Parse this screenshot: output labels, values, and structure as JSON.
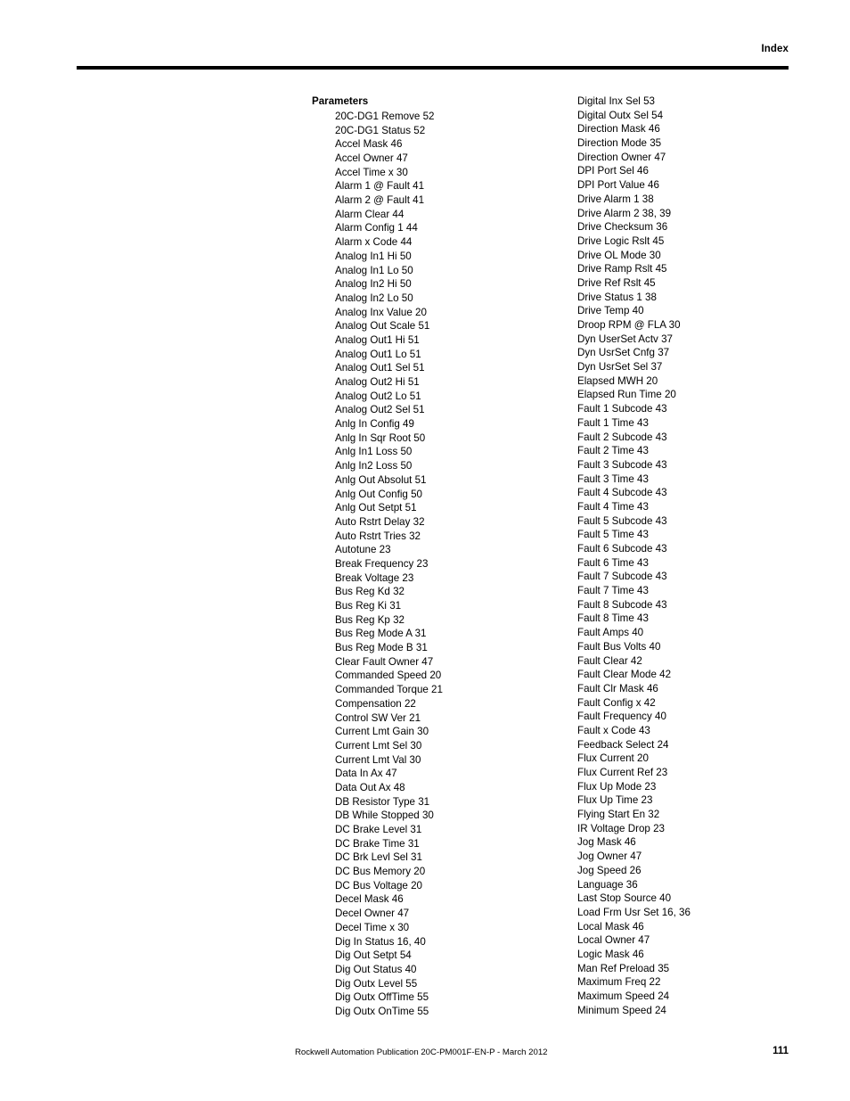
{
  "header": {
    "title": "Index"
  },
  "index": {
    "left_column": {
      "heading": "Parameters",
      "entries": [
        "20C-DG1 Remove 52",
        "20C-DG1 Status 52",
        "Accel Mask 46",
        "Accel Owner 47",
        "Accel Time x 30",
        "Alarm 1 @ Fault 41",
        "Alarm 2 @ Fault 41",
        "Alarm Clear 44",
        "Alarm Config 1 44",
        "Alarm x Code 44",
        "Analog In1 Hi 50",
        "Analog In1 Lo 50",
        "Analog In2 Hi 50",
        "Analog In2 Lo 50",
        "Analog Inx Value 20",
        "Analog Out Scale 51",
        "Analog Out1 Hi 51",
        "Analog Out1 Lo 51",
        "Analog Out1 Sel 51",
        "Analog Out2 Hi 51",
        "Analog Out2 Lo 51",
        "Analog Out2 Sel 51",
        "Anlg In Config 49",
        "Anlg In Sqr Root 50",
        "Anlg In1 Loss 50",
        "Anlg In2 Loss 50",
        "Anlg Out Absolut 51",
        "Anlg Out Config 50",
        "Anlg Out Setpt 51",
        "Auto Rstrt Delay 32",
        "Auto Rstrt Tries 32",
        "Autotune 23",
        "Break Frequency 23",
        "Break Voltage 23",
        "Bus Reg Kd 32",
        "Bus Reg Ki 31",
        "Bus Reg Kp 32",
        "Bus Reg Mode A 31",
        "Bus Reg Mode B 31",
        "Clear Fault Owner 47",
        "Commanded Speed 20",
        "Commanded Torque 21",
        "Compensation 22",
        "Control SW Ver 21",
        "Current Lmt Gain 30",
        "Current Lmt Sel 30",
        "Current Lmt Val 30",
        "Data In Ax 47",
        "Data Out Ax 48",
        "DB Resistor Type 31",
        "DB While Stopped 30",
        "DC Brake Level 31",
        "DC Brake Time 31",
        "DC Brk Levl Sel 31",
        "DC Bus Memory 20",
        "DC Bus Voltage 20",
        "Decel Mask 46",
        "Decel Owner 47",
        "Decel Time x 30",
        "Dig In Status 16, 40",
        "Dig Out Setpt 54",
        "Dig Out Status 40",
        "Dig Outx Level 55",
        "Dig Outx OffTime 55",
        "Dig Outx OnTime 55"
      ]
    },
    "right_column": {
      "entries": [
        "Digital Inx Sel 53",
        "Digital Outx Sel 54",
        "Direction Mask 46",
        "Direction Mode 35",
        "Direction Owner 47",
        "DPI Port Sel 46",
        "DPI Port Value 46",
        "Drive Alarm 1 38",
        "Drive Alarm 2 38, 39",
        "Drive Checksum 36",
        "Drive Logic Rslt 45",
        "Drive OL Mode 30",
        "Drive Ramp Rslt 45",
        "Drive Ref Rslt 45",
        "Drive Status 1 38",
        "Drive Temp 40",
        "Droop RPM @ FLA 30",
        "Dyn UserSet Actv 37",
        "Dyn UsrSet Cnfg 37",
        "Dyn UsrSet Sel 37",
        "Elapsed MWH 20",
        "Elapsed Run Time 20",
        "Fault 1 Subcode 43",
        "Fault 1 Time 43",
        "Fault 2 Subcode 43",
        "Fault 2 Time 43",
        "Fault 3 Subcode 43",
        "Fault 3 Time 43",
        "Fault 4 Subcode 43",
        "Fault 4 Time 43",
        "Fault 5 Subcode 43",
        "Fault 5 Time 43",
        "Fault 6 Subcode 43",
        "Fault 6 Time 43",
        "Fault 7 Subcode 43",
        "Fault 7 Time 43",
        "Fault 8 Subcode 43",
        "Fault 8 Time 43",
        "Fault Amps 40",
        "Fault Bus Volts 40",
        "Fault Clear 42",
        "Fault Clear Mode 42",
        "Fault Clr Mask 46",
        "Fault Config x 42",
        "Fault Frequency 40",
        "Fault x Code 43",
        "Feedback Select 24",
        "Flux Current 20",
        "Flux Current Ref 23",
        "Flux Up Mode 23",
        "Flux Up Time 23",
        "Flying Start En 32",
        "IR Voltage Drop 23",
        "Jog Mask 46",
        "Jog Owner 47",
        "Jog Speed 26",
        "Language 36",
        "Last Stop Source 40",
        "Load Frm Usr Set 16, 36",
        "Local Mask 46",
        "Local Owner 47",
        "Logic Mask 46",
        "Man Ref Preload 35",
        "Maximum Freq 22",
        "Maximum Speed 24",
        "Minimum Speed 24"
      ]
    }
  },
  "footer": {
    "publication": "Rockwell Automation Publication 20C-PM001F-EN-P - March 2012",
    "page_number": "111"
  }
}
